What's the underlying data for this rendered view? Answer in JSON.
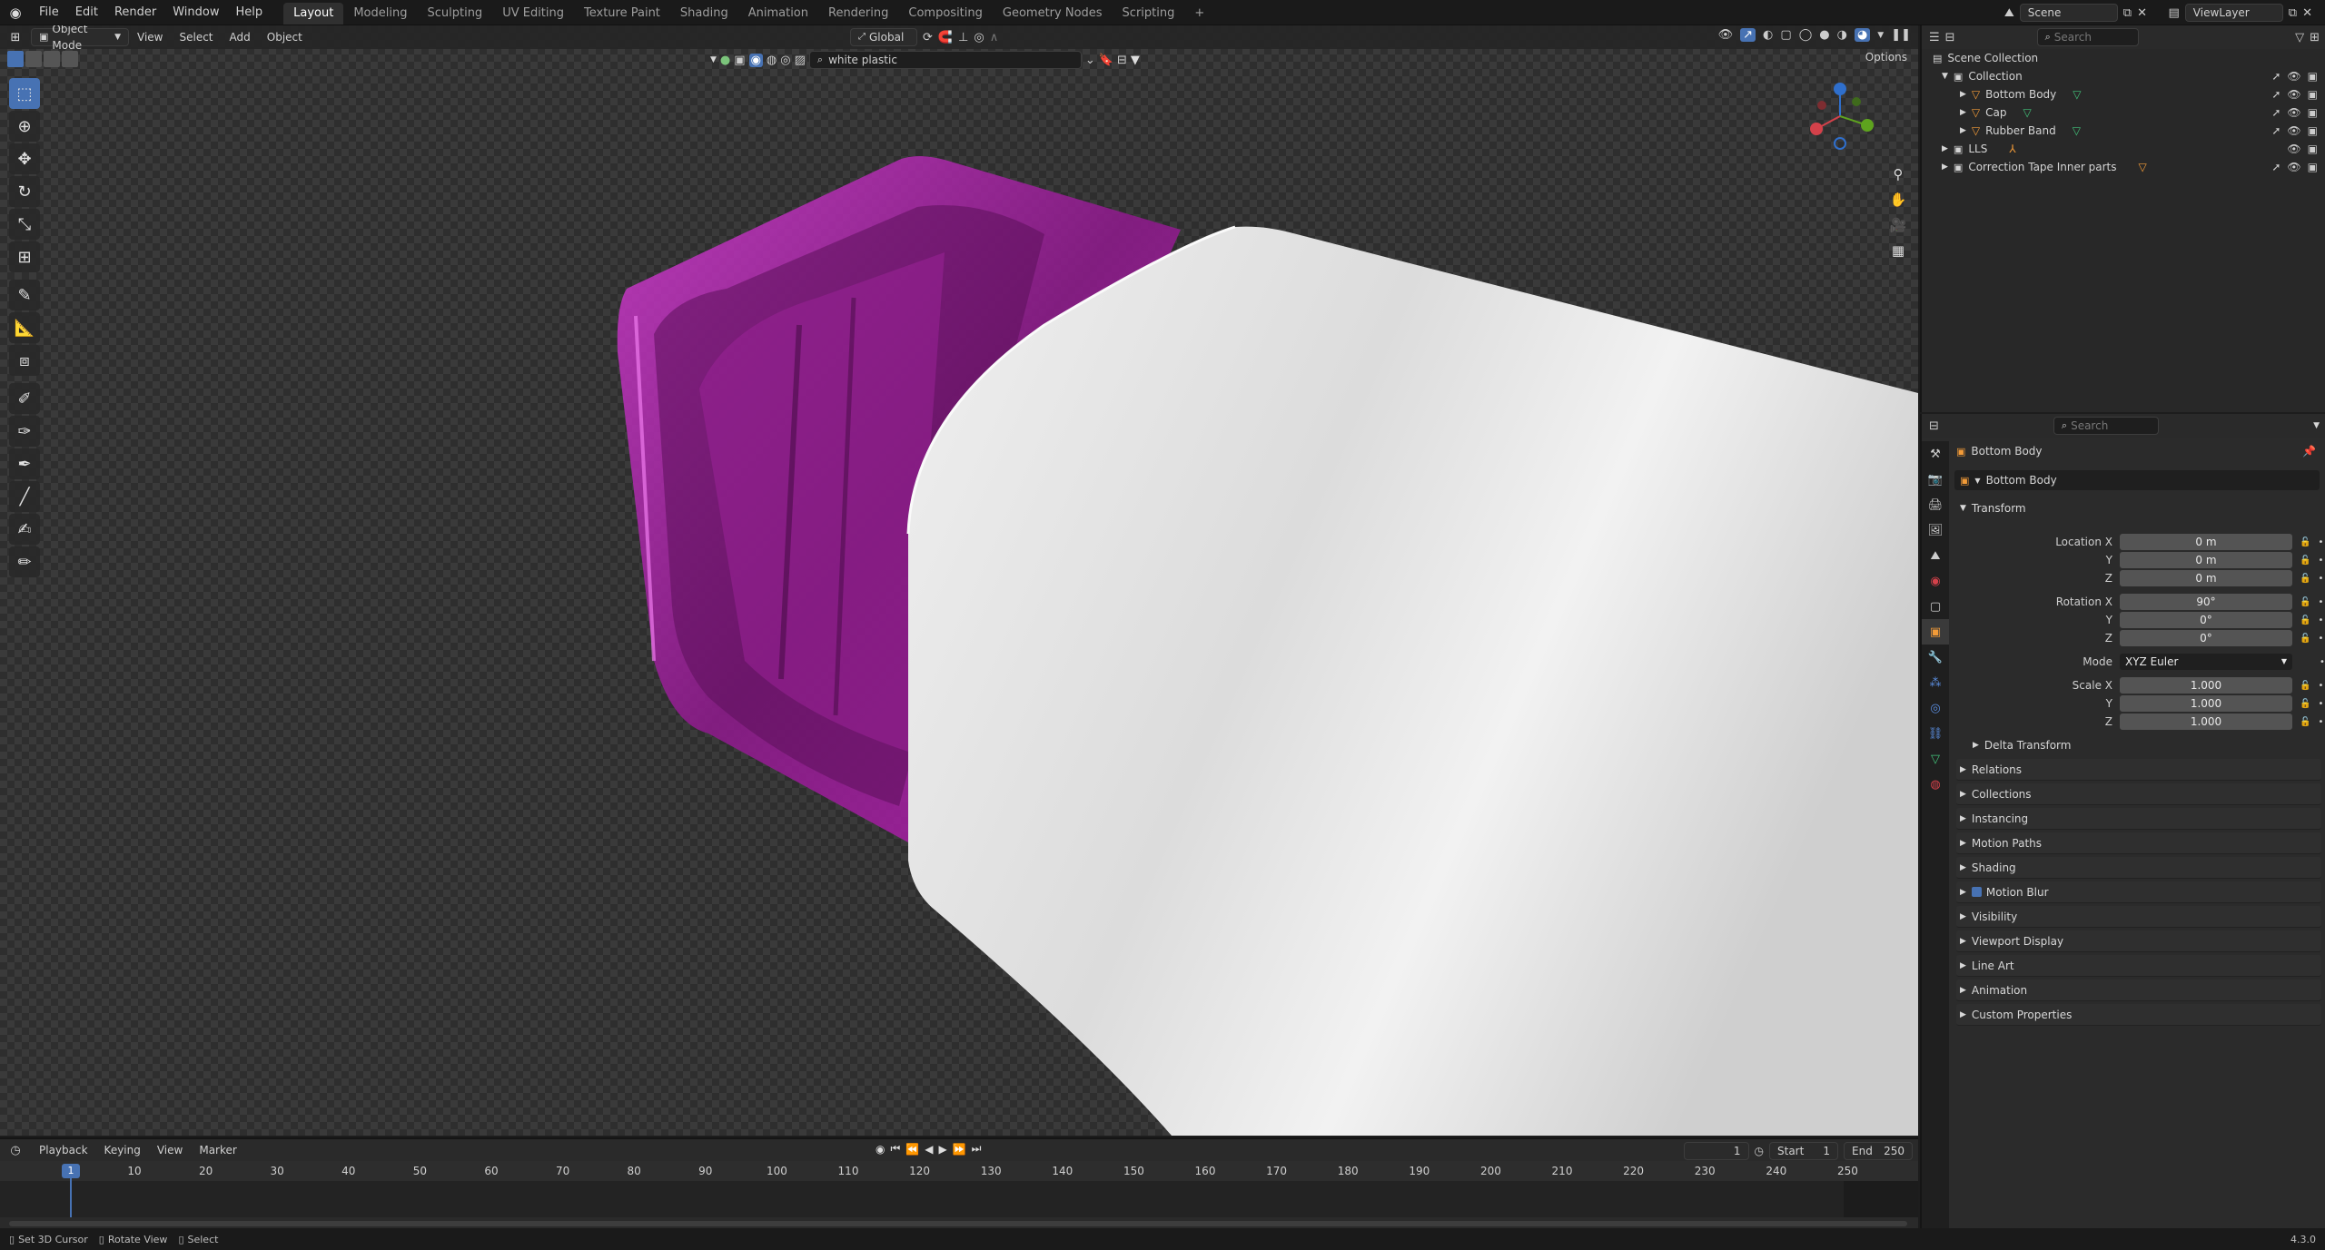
{
  "topbar": {
    "menus": [
      "File",
      "Edit",
      "Render",
      "Window",
      "Help"
    ],
    "workspaces": [
      "Layout",
      "Modeling",
      "Sculpting",
      "UV Editing",
      "Texture Paint",
      "Shading",
      "Animation",
      "Rendering",
      "Compositing",
      "Geometry Nodes",
      "Scripting"
    ],
    "active_workspace": "Layout",
    "add_tab": "+",
    "scene_label": "Scene",
    "viewlayer_label": "ViewLayer"
  },
  "viewport": {
    "mode": "Object Mode",
    "menus": [
      "View",
      "Select",
      "Add",
      "Object"
    ],
    "transform_orientation": "Global",
    "material_search": "white plastic",
    "options_label": "Options"
  },
  "outliner": {
    "search_placeholder": "Search",
    "scene_collection": "Scene Collection",
    "rows": [
      {
        "label": "Collection"
      },
      {
        "label": "Bottom Body"
      },
      {
        "label": "Cap"
      },
      {
        "label": "Rubber Band"
      },
      {
        "label": "LLS"
      },
      {
        "label": "Correction Tape Inner parts"
      }
    ]
  },
  "properties": {
    "search_placeholder": "Search",
    "object_name": "Bottom Body",
    "object_datablock": "Bottom Body",
    "transform_header": "Transform",
    "location_label": "Location X",
    "location": [
      "0 m",
      "0 m",
      "0 m"
    ],
    "rotation_label": "Rotation X",
    "rotation": [
      "90°",
      "0°",
      "0°"
    ],
    "y_label": "Y",
    "z_label": "Z",
    "mode_label": "Mode",
    "mode_value": "XYZ Euler",
    "scale_label": "Scale X",
    "scale": [
      "1.000",
      "1.000",
      "1.000"
    ],
    "delta_transform": "Delta Transform",
    "panels": [
      "Relations",
      "Collections",
      "Instancing",
      "Motion Paths",
      "Shading",
      "Motion Blur",
      "Visibility",
      "Viewport Display",
      "Line Art",
      "Animation",
      "Custom Properties"
    ]
  },
  "timeline": {
    "menus": [
      "Playback",
      "Keying",
      "View",
      "Marker"
    ],
    "current_frame": "1",
    "start_label": "Start",
    "start_value": "1",
    "end_label": "End",
    "end_value": "250",
    "ticks": [
      "10",
      "20",
      "30",
      "40",
      "50",
      "60",
      "70",
      "80",
      "90",
      "100",
      "110",
      "120",
      "130",
      "140",
      "150",
      "160",
      "170",
      "180",
      "190",
      "200",
      "210",
      "220",
      "230",
      "240",
      "250"
    ],
    "playhead": "1"
  },
  "statusbar": {
    "hints": [
      "Set 3D Cursor",
      "Rotate View",
      "Select"
    ],
    "version": "4.3.0"
  },
  "colors": {
    "accent": "#4772b3",
    "magenta_material": "#b21fb0",
    "white_material": "#e6e6e6"
  }
}
